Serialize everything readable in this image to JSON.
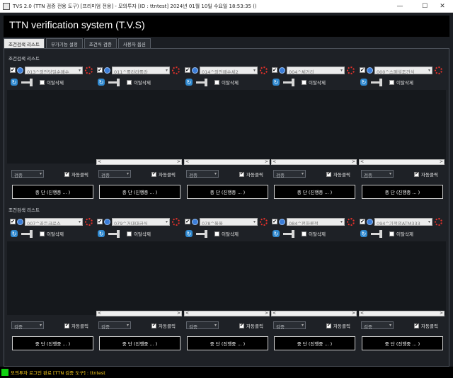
{
  "window": {
    "title": "TVS 2.0 (TTN 검증 전용 도구) [프리미엄 전용] - 모의투자 [ID : ttntest] 2024년 01월 10일 수요일 18:53:35 ()",
    "min": "—",
    "max": "☐",
    "close": "✕"
  },
  "app": {
    "heading": "TTN verification system (T.V.S)"
  },
  "tabs": [
    "조건검색 리스트",
    "부가기능 설정",
    "조건식 검증",
    "사용자 옵션"
  ],
  "sections": [
    {
      "title": "조건검색 리스트",
      "cards": [
        {
          "condition": "013^외인당일순매수",
          "checked": true
        },
        {
          "condition": "011^롤라라롤라",
          "checked": true
        },
        {
          "condition": "014^외인매수세2",
          "checked": true
        },
        {
          "condition": "004^체거리",
          "checked": true
        },
        {
          "condition": "000^스페셜조건식",
          "checked": true
        }
      ]
    },
    {
      "title": "조건검색 리스트",
      "cards": [
        {
          "condition": "007^골든크로스",
          "checked": true
        },
        {
          "condition": "079^거대대금식",
          "checked": true
        },
        {
          "condition": "078^올올",
          "checked": true
        },
        {
          "condition": "084^전하루적",
          "checked": true
        },
        {
          "condition": "094^기적의ATM333",
          "checked": true
        }
      ]
    }
  ],
  "labels": {
    "remove": "이탈삭제",
    "verify": "검증",
    "auto_click": "자동클릭",
    "stop": "중 단 (진행중 ... )",
    "check": "✔",
    "refresh": "↻",
    "scroll_left": "<",
    "scroll_right": ">",
    "caret": "▾"
  },
  "status": {
    "text": "모의투자 로그인 완료 [TTN 검증 도구] : ttntest"
  }
}
